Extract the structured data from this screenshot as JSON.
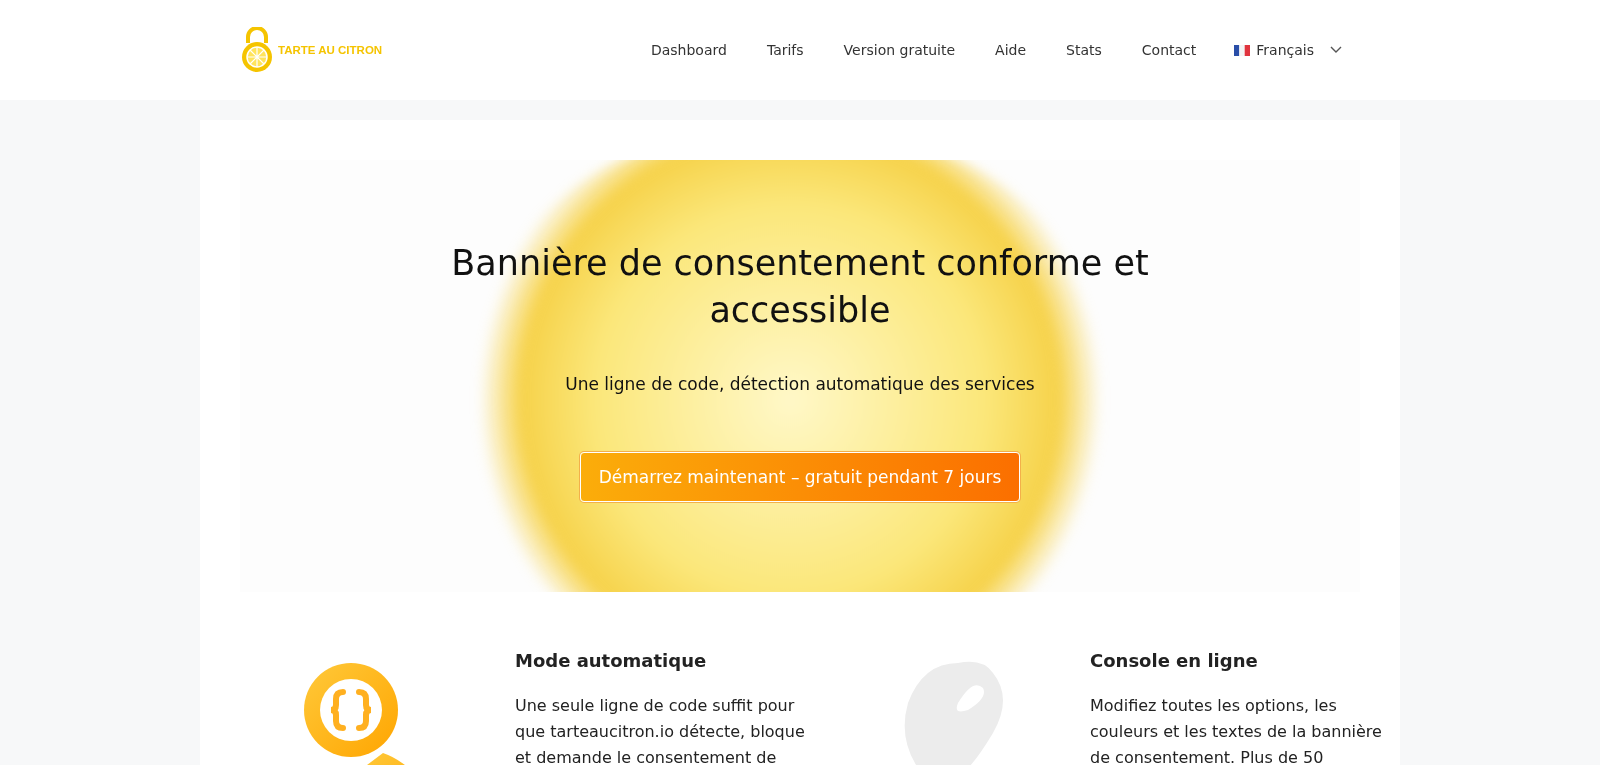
{
  "header": {
    "logo_text": "TARTE AU CITRON",
    "nav": [
      {
        "label": "Dashboard"
      },
      {
        "label": "Tarifs"
      },
      {
        "label": "Version gratuite"
      },
      {
        "label": "Aide"
      },
      {
        "label": "Stats"
      },
      {
        "label": "Contact"
      }
    ],
    "language": "Français"
  },
  "hero": {
    "title": "Bannière de consentement conforme et accessible",
    "subtitle": "Une ligne de code, détection automatique des services",
    "cta": "Démarrez maintenant – gratuit pendant 7 jours"
  },
  "features": [
    {
      "kind": "magnifier",
      "title": "Mode automatique",
      "text": "Une seule ligne de code suffit pour que tarteaucitron.io détecte, bloque et demande le consentement de"
    },
    {
      "kind": "palette",
      "title": "Console en ligne",
      "text": "Modifiez toutes les options, les couleurs et les textes de la bannière de consentement. Plus de 50"
    }
  ]
}
